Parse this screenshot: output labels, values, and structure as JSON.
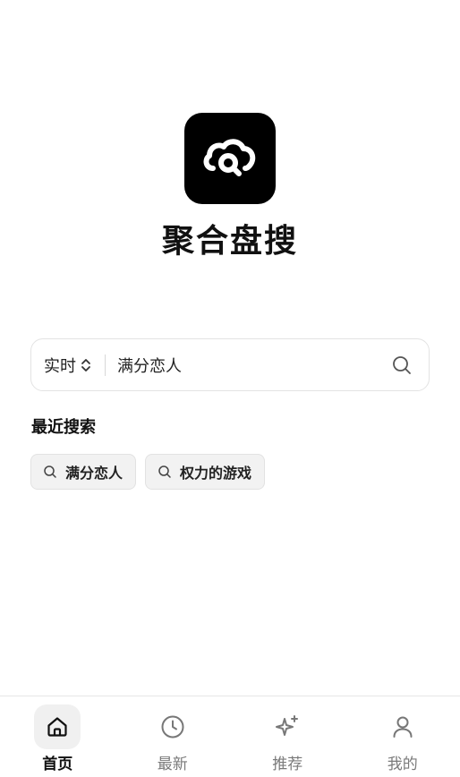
{
  "app": {
    "title": "聚合盘搜",
    "logo_icon": "cloud-search-icon"
  },
  "search": {
    "mode_label": "实时",
    "value": "满分恋人",
    "placeholder": ""
  },
  "recent": {
    "title": "最近搜索",
    "items": [
      {
        "label": "满分恋人"
      },
      {
        "label": "权力的游戏"
      }
    ]
  },
  "nav": {
    "items": [
      {
        "label": "首页",
        "icon": "home-icon",
        "active": true
      },
      {
        "label": "最新",
        "icon": "clock-icon",
        "active": false
      },
      {
        "label": "推荐",
        "icon": "sparkle-icon",
        "active": false
      },
      {
        "label": "我的",
        "icon": "user-icon",
        "active": false
      }
    ]
  },
  "colors": {
    "logo_bg": "#000000",
    "chip_bg": "#f2f2f2",
    "active_nav_bg": "#f0f0f0",
    "inactive_text": "#7a7a7a"
  }
}
